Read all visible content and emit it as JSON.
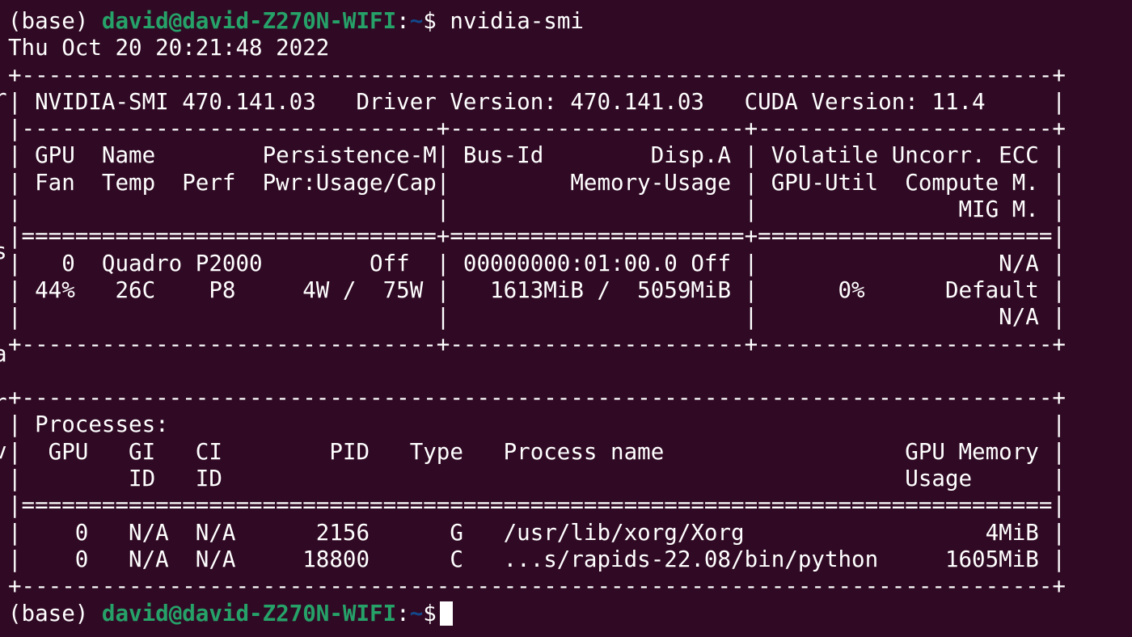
{
  "prompt": {
    "env": "(base)",
    "user_host": "david@david-Z270N-WIFI",
    "sep": ":",
    "path": "~",
    "symbol": "$"
  },
  "command": "nvidia-smi",
  "output_lines": [
    "Thu Oct 20 20:21:48 2022",
    "+-----------------------------------------------------------------------------+",
    "| NVIDIA-SMI 470.141.03   Driver Version: 470.141.03   CUDA Version: 11.4     |",
    "|-------------------------------+----------------------+----------------------+",
    "| GPU  Name        Persistence-M| Bus-Id        Disp.A | Volatile Uncorr. ECC |",
    "| Fan  Temp  Perf  Pwr:Usage/Cap|         Memory-Usage | GPU-Util  Compute M. |",
    "|                               |                      |               MIG M. |",
    "|===============================+======================+======================|",
    "|   0  Quadro P2000        Off  | 00000000:01:00.0 Off |                  N/A |",
    "| 44%   26C    P8     4W /  75W |   1613MiB /  5059MiB |      0%      Default |",
    "|                               |                      |                  N/A |",
    "+-------------------------------+----------------------+----------------------+",
    "",
    "+-----------------------------------------------------------------------------+",
    "| Processes:                                                                  |",
    "|  GPU   GI   CI        PID   Type   Process name                  GPU Memory |",
    "|        ID   ID                                                   Usage      |",
    "|=============================================================================|",
    "|    0   N/A  N/A      2156      G   /usr/lib/xorg/Xorg                  4MiB |",
    "|    0   N/A  N/A     18800      C   ...s/rapids-22.08/bin/python     1605MiB |",
    "+-----------------------------------------------------------------------------+"
  ],
  "bleed_chars": [
    "r",
    "s",
    "a",
    "r",
    "v"
  ]
}
